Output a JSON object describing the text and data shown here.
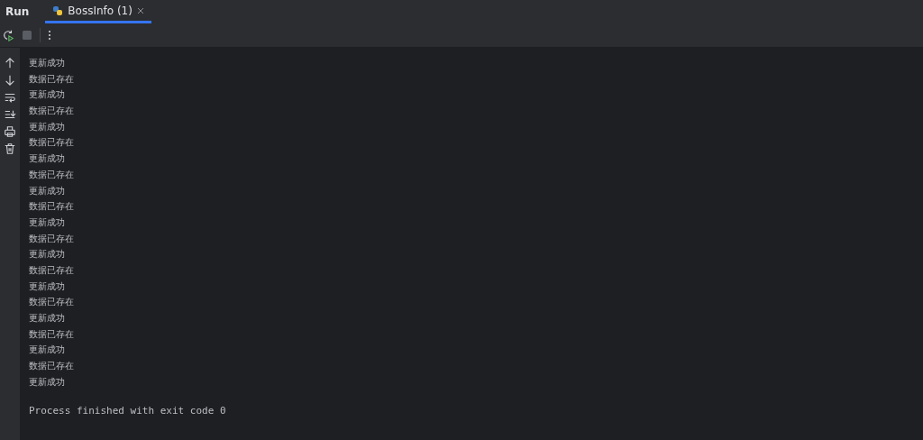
{
  "panel": {
    "title": "Run"
  },
  "tabs": [
    {
      "label": "BossInfo (1)",
      "selected": true
    }
  ],
  "console": {
    "lines": [
      "更新成功",
      "数据已存在",
      "更新成功",
      "数据已存在",
      "更新成功",
      "数据已存在",
      "更新成功",
      "数据已存在",
      "更新成功",
      "数据已存在",
      "更新成功",
      "数据已存在",
      "更新成功",
      "数据已存在",
      "更新成功",
      "数据已存在",
      "更新成功",
      "数据已存在",
      "更新成功",
      "数据已存在",
      "更新成功"
    ],
    "exit_message": "Process finished with exit code 0"
  }
}
